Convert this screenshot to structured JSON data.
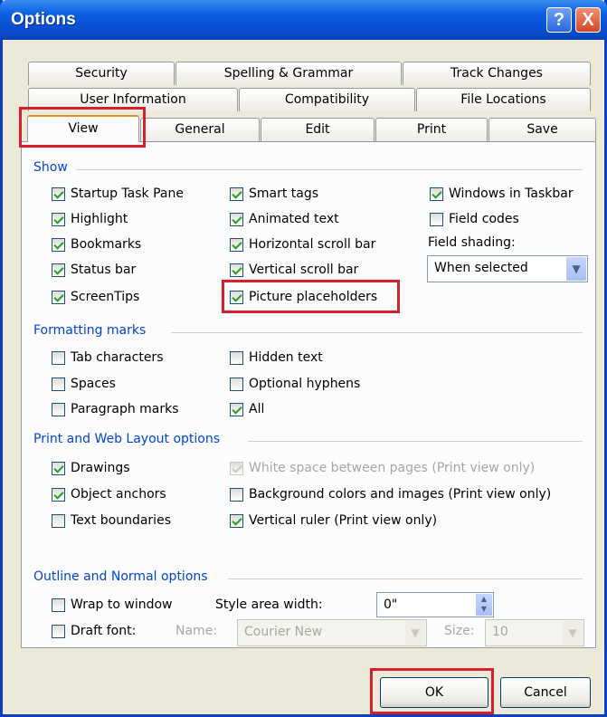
{
  "window": {
    "title": "Options",
    "help_glyph": "?",
    "close_glyph": "X"
  },
  "tabs": {
    "row1": [
      "Security",
      "Spelling & Grammar",
      "Track Changes"
    ],
    "row2": [
      "User Information",
      "Compatibility",
      "File Locations"
    ],
    "row3": [
      "View",
      "General",
      "Edit",
      "Print",
      "Save"
    ],
    "active": "View"
  },
  "show": {
    "label": "Show",
    "startup_task_pane": "Startup Task Pane",
    "highlight": "Highlight",
    "bookmarks": "Bookmarks",
    "status_bar": "Status bar",
    "screentips": "ScreenTips",
    "smart_tags": "Smart tags",
    "animated_text": "Animated text",
    "horizontal_scroll_bar": "Horizontal scroll bar",
    "vertical_scroll_bar": "Vertical scroll bar",
    "picture_placeholders": "Picture placeholders",
    "windows_in_taskbar": "Windows in Taskbar",
    "field_codes": "Field codes",
    "field_shading_label": "Field shading:",
    "field_shading_value": "When selected"
  },
  "formatting_marks": {
    "label": "Formatting marks",
    "tab_characters": "Tab characters",
    "spaces": "Spaces",
    "paragraph_marks": "Paragraph marks",
    "hidden_text": "Hidden text",
    "optional_hyphens": "Optional hyphens",
    "all": "All"
  },
  "print_web": {
    "label": "Print and Web Layout options",
    "drawings": "Drawings",
    "object_anchors": "Object anchors",
    "text_boundaries": "Text boundaries",
    "white_space": "White space between pages (Print view only)",
    "background_colors": "Background colors and images (Print view only)",
    "vertical_ruler": "Vertical ruler (Print view only)"
  },
  "outline_normal": {
    "label": "Outline and Normal options",
    "wrap_to_window": "Wrap to window",
    "draft_font": "Draft font:",
    "style_area_width_label": "Style area width:",
    "style_area_width_value": "0\"",
    "name_label": "Name:",
    "name_value": "Courier New",
    "size_label": "Size:",
    "size_value": "10"
  },
  "buttons": {
    "ok": "OK",
    "cancel": "Cancel"
  },
  "colors": {
    "title_bar": "#0a4fd1",
    "group_label": "#0046d5",
    "highlight_box": "#d7202a",
    "check": "#21a121"
  }
}
